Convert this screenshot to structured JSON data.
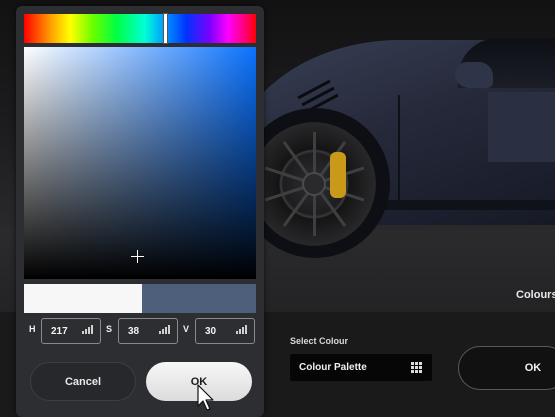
{
  "scene": {
    "colours_label": "Colours"
  },
  "bottom_bar": {
    "select_colour_label": "Select Colour",
    "palette_dropdown_value": "Colour Palette",
    "ok_label": "OK"
  },
  "picker": {
    "hue_field": {
      "label": "H",
      "value": "217"
    },
    "saturation_field": {
      "label": "S",
      "value": "38"
    },
    "value_field": {
      "label": "V",
      "value": "30"
    },
    "old_colour": "#f7f7f7",
    "new_colour": "#4d5f7a",
    "cancel_label": "Cancel",
    "ok_label": "OK"
  },
  "icons": [
    "grid-icon",
    "signal-bars-icon",
    "mouse-pointer-icon",
    "crosshair-icon"
  ]
}
